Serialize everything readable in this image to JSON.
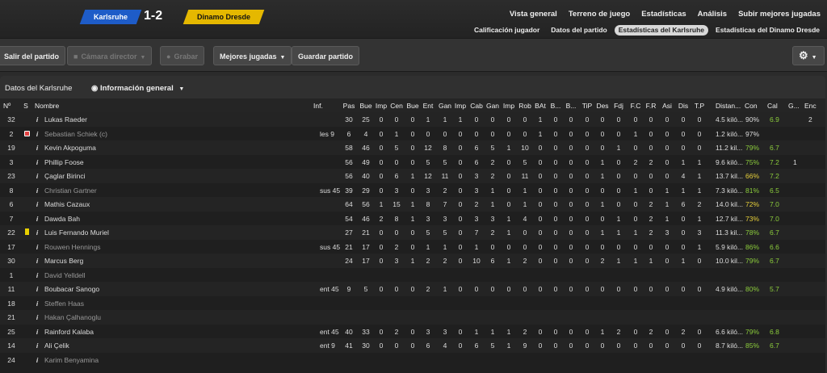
{
  "match": {
    "home": "Karlsruhe",
    "away": "Dinamo Dresde",
    "score": "1-2"
  },
  "nav_main": [
    "Vista general",
    "Terreno de juego",
    "Estadísticas",
    "Análisis",
    "Subir mejores jugadas"
  ],
  "nav_sub": [
    "Calificación jugador",
    "Datos del partido",
    "Estadísticas del Karlsruhe",
    "Estadísticas del Dinamo Dresde"
  ],
  "toolbar": {
    "exit": "Salir del partido",
    "camera": "Cámara director",
    "record": "Grabar",
    "highlights": "Mejores jugadas",
    "save": "Guardar partido"
  },
  "panel": {
    "title": "Datos del Karlsruhe",
    "view": "Información general"
  },
  "columns": [
    "Nº",
    "S",
    "Nombre",
    "Inf.",
    "Pas",
    "Bue",
    "Imp",
    "Cen",
    "Bue",
    "Ent",
    "Gan",
    "Imp",
    "Cab",
    "Gan",
    "Imp",
    "Rob",
    "BAt",
    "B...",
    "B...",
    "TiP",
    "Des",
    "Fdj",
    "F.C",
    "F.R",
    "Asi",
    "Dis",
    "T.P",
    "Distan...",
    "Con",
    "Cal",
    "G...",
    "Enc"
  ],
  "rows": [
    {
      "n": "32",
      "s": "",
      "name": "Lukas Raeder",
      "inf": "",
      "stats": [
        "30",
        "25",
        "0",
        "0",
        "0",
        "1",
        "1",
        "1",
        "0",
        "0",
        "0",
        "0",
        "1",
        "0",
        "0",
        "0",
        "0",
        "0",
        "0",
        "0",
        "0",
        "0",
        "0"
      ],
      "dist": "4.5 kiló...",
      "con": "90%",
      "cal": "6.9",
      "g": "",
      "enc": "2",
      "sub": false
    },
    {
      "n": "2",
      "s": "capt",
      "name": "Sebastian Schiek (c)",
      "inf": "les 9",
      "stats": [
        "6",
        "4",
        "0",
        "1",
        "0",
        "0",
        "0",
        "0",
        "0",
        "0",
        "0",
        "0",
        "1",
        "0",
        "0",
        "0",
        "0",
        "0",
        "1",
        "0",
        "0",
        "0",
        "0"
      ],
      "dist": "1.2 kiló...",
      "con": "97%",
      "cal": "",
      "g": "",
      "enc": "",
      "sub": true
    },
    {
      "n": "19",
      "s": "",
      "name": "Kevin Akpoguma",
      "inf": "",
      "stats": [
        "58",
        "46",
        "0",
        "5",
        "0",
        "12",
        "8",
        "0",
        "6",
        "5",
        "1",
        "10",
        "0",
        "0",
        "0",
        "0",
        "0",
        "1",
        "0",
        "0",
        "0",
        "0",
        "0"
      ],
      "dist": "11.2 kil...",
      "con": "79%",
      "cal": "6.7",
      "g": "",
      "enc": "",
      "sub": false
    },
    {
      "n": "3",
      "s": "",
      "name": "Phillip Foose",
      "inf": "",
      "stats": [
        "56",
        "49",
        "0",
        "0",
        "0",
        "5",
        "5",
        "0",
        "6",
        "2",
        "0",
        "5",
        "0",
        "0",
        "0",
        "0",
        "1",
        "0",
        "2",
        "2",
        "0",
        "1",
        "1"
      ],
      "dist": "9.6 kiló...",
      "con": "75%",
      "cal": "7.2",
      "g": "1",
      "enc": "",
      "sub": false
    },
    {
      "n": "23",
      "s": "",
      "name": "Çaglar Birinci",
      "inf": "",
      "stats": [
        "56",
        "40",
        "0",
        "6",
        "1",
        "12",
        "11",
        "0",
        "3",
        "2",
        "0",
        "11",
        "0",
        "0",
        "0",
        "0",
        "1",
        "0",
        "0",
        "0",
        "0",
        "4",
        "1"
      ],
      "dist": "13.7 kil...",
      "con": "66%",
      "cal": "7.2",
      "g": "",
      "enc": "",
      "sub": false
    },
    {
      "n": "8",
      "s": "",
      "name": "Christian Gartner",
      "inf": "sus 45",
      "stats": [
        "39",
        "29",
        "0",
        "3",
        "0",
        "3",
        "2",
        "0",
        "3",
        "1",
        "0",
        "1",
        "0",
        "0",
        "0",
        "0",
        "0",
        "0",
        "1",
        "0",
        "1",
        "1",
        "1"
      ],
      "dist": "7.3 kiló...",
      "con": "81%",
      "cal": "6.5",
      "g": "",
      "enc": "",
      "sub": true
    },
    {
      "n": "6",
      "s": "",
      "name": "Mathis Cazaux",
      "inf": "",
      "stats": [
        "64",
        "56",
        "1",
        "15",
        "1",
        "8",
        "7",
        "0",
        "2",
        "1",
        "0",
        "1",
        "0",
        "0",
        "0",
        "0",
        "1",
        "0",
        "0",
        "2",
        "1",
        "6",
        "2"
      ],
      "dist": "14.0 kil...",
      "con": "72%",
      "cal": "7.0",
      "g": "",
      "enc": "",
      "sub": false
    },
    {
      "n": "7",
      "s": "",
      "name": "Dawda Bah",
      "inf": "",
      "stats": [
        "54",
        "46",
        "2",
        "8",
        "1",
        "3",
        "3",
        "0",
        "3",
        "3",
        "1",
        "4",
        "0",
        "0",
        "0",
        "0",
        "0",
        "1",
        "0",
        "2",
        "1",
        "0",
        "1"
      ],
      "dist": "12.7 kil...",
      "con": "73%",
      "cal": "7.0",
      "g": "",
      "enc": "",
      "sub": false
    },
    {
      "n": "22",
      "s": "yellow",
      "name": "Luis Fernando Muriel",
      "inf": "",
      "stats": [
        "27",
        "21",
        "0",
        "0",
        "0",
        "5",
        "5",
        "0",
        "7",
        "2",
        "1",
        "0",
        "0",
        "0",
        "0",
        "0",
        "1",
        "1",
        "1",
        "2",
        "3",
        "0",
        "3"
      ],
      "dist": "11.3 kil...",
      "con": "78%",
      "cal": "6.7",
      "g": "",
      "enc": "",
      "sub": false
    },
    {
      "n": "17",
      "s": "",
      "name": "Rouwen Hennings",
      "inf": "sus 45",
      "stats": [
        "21",
        "17",
        "0",
        "2",
        "0",
        "1",
        "1",
        "0",
        "1",
        "0",
        "0",
        "0",
        "0",
        "0",
        "0",
        "0",
        "0",
        "0",
        "0",
        "0",
        "0",
        "0",
        "1"
      ],
      "dist": "5.9 kiló...",
      "con": "86%",
      "cal": "6.6",
      "g": "",
      "enc": "",
      "sub": true
    },
    {
      "n": "30",
      "s": "",
      "name": "Marcus Berg",
      "inf": "",
      "stats": [
        "24",
        "17",
        "0",
        "3",
        "1",
        "2",
        "2",
        "0",
        "10",
        "6",
        "1",
        "2",
        "0",
        "0",
        "0",
        "0",
        "2",
        "1",
        "1",
        "1",
        "0",
        "1",
        "0"
      ],
      "dist": "10.0 kil...",
      "con": "79%",
      "cal": "6.7",
      "g": "",
      "enc": "",
      "sub": false
    },
    {
      "n": "1",
      "s": "",
      "name": "David Yelldell",
      "inf": "",
      "stats": [],
      "dist": "",
      "con": "",
      "cal": "",
      "g": "",
      "enc": "",
      "sub": true
    },
    {
      "n": "11",
      "s": "",
      "name": "Boubacar Sanogo",
      "inf": "ent 45",
      "stats": [
        "9",
        "5",
        "0",
        "0",
        "0",
        "2",
        "1",
        "0",
        "0",
        "0",
        "0",
        "0",
        "0",
        "0",
        "0",
        "0",
        "0",
        "0",
        "0",
        "0",
        "0",
        "0",
        "0"
      ],
      "dist": "4.9 kiló...",
      "con": "80%",
      "cal": "5.7",
      "g": "",
      "enc": "",
      "sub": false
    },
    {
      "n": "18",
      "s": "",
      "name": "Steffen Haas",
      "inf": "",
      "stats": [],
      "dist": "",
      "con": "",
      "cal": "",
      "g": "",
      "enc": "",
      "sub": true
    },
    {
      "n": "21",
      "s": "",
      "name": "Hakan Çalhanoglu",
      "inf": "",
      "stats": [],
      "dist": "",
      "con": "",
      "cal": "",
      "g": "",
      "enc": "",
      "sub": true
    },
    {
      "n": "25",
      "s": "",
      "name": "Rainford Kalaba",
      "inf": "ent 45",
      "stats": [
        "40",
        "33",
        "0",
        "2",
        "0",
        "3",
        "3",
        "0",
        "1",
        "1",
        "1",
        "2",
        "0",
        "0",
        "0",
        "0",
        "1",
        "2",
        "0",
        "2",
        "0",
        "2",
        "0"
      ],
      "dist": "6.6 kiló...",
      "con": "79%",
      "cal": "6.8",
      "g": "",
      "enc": "",
      "sub": false
    },
    {
      "n": "14",
      "s": "",
      "name": "Ali Çelik",
      "inf": "ent 9",
      "stats": [
        "41",
        "30",
        "0",
        "0",
        "0",
        "6",
        "4",
        "0",
        "6",
        "5",
        "1",
        "9",
        "0",
        "0",
        "0",
        "0",
        "0",
        "0",
        "0",
        "0",
        "0",
        "0",
        "0"
      ],
      "dist": "8.7 kiló...",
      "con": "85%",
      "cal": "6.7",
      "g": "",
      "enc": "",
      "sub": false
    },
    {
      "n": "24",
      "s": "",
      "name": "Karim Benyamina",
      "inf": "",
      "stats": [],
      "dist": "",
      "con": "",
      "cal": "",
      "g": "",
      "enc": "",
      "sub": true
    }
  ]
}
